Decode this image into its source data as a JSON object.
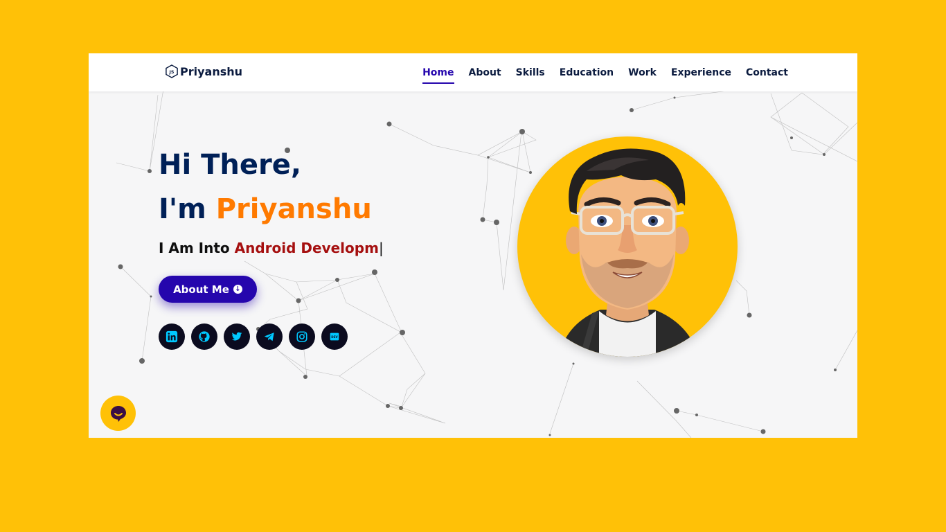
{
  "brand": {
    "name": "Priyanshu",
    "icon": "nodejs-hexagon-icon"
  },
  "nav": {
    "items": [
      {
        "label": "Home",
        "active": true
      },
      {
        "label": "About",
        "active": false
      },
      {
        "label": "Skills",
        "active": false
      },
      {
        "label": "Education",
        "active": false
      },
      {
        "label": "Work",
        "active": false
      },
      {
        "label": "Experience",
        "active": false
      },
      {
        "label": "Contact",
        "active": false
      }
    ]
  },
  "hero": {
    "greeting": "Hi There,",
    "intro_prefix": "I'm ",
    "name": "Priyanshu",
    "typing_prefix": "I Am Into ",
    "typing_text": "Android Developm",
    "cursor": "|",
    "about_button": "About Me",
    "about_button_icon": "arrow-down-circle-icon"
  },
  "socials": [
    {
      "name": "linkedin",
      "icon": "linkedin-icon"
    },
    {
      "name": "github",
      "icon": "github-icon"
    },
    {
      "name": "twitter",
      "icon": "twitter-icon"
    },
    {
      "name": "telegram",
      "icon": "telegram-icon"
    },
    {
      "name": "instagram",
      "icon": "instagram-icon"
    },
    {
      "name": "dev",
      "icon": "dev-icon",
      "label": "DEV"
    }
  ],
  "avatar": {
    "image": "memoji-avatar-glasses-beard"
  },
  "chat_widget": {
    "icon": "chat-bubble-icon"
  },
  "colors": {
    "page_background": "#FFC107",
    "navy": "#002057",
    "accent_orange": "#ff7a00",
    "accent_red": "#a50f0f",
    "button_blue": "#2506ad",
    "social_icon": "#00c8ff"
  }
}
